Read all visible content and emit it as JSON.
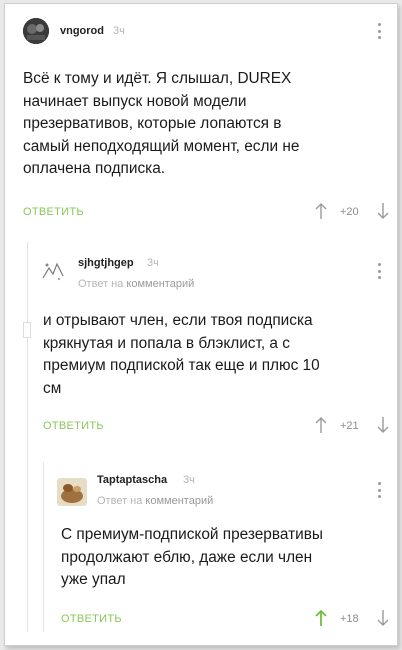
{
  "comments": [
    {
      "username": "vngorod",
      "time": "3ч",
      "text_lines": [
        "Всё к тому и идёт. Я слышал, DUREX",
        "начинает выпуск новой модели",
        "презервативов, которые лопаются в",
        "самый неподходящий момент, если не",
        "оплачена подписка."
      ],
      "reply_label": "ОТВЕТИТЬ",
      "rating": "+20",
      "upvoted": false
    },
    {
      "username": "sjhgtjhgep",
      "time": "3ч",
      "reply_to_prefix": "Ответ на",
      "reply_to_link": "комментарий",
      "text_lines": [
        "и отрывают член, если твоя подписка",
        "крякнутая и попала в блэклист, а с",
        "премиум подпиской так еще и плюс 10",
        "см"
      ],
      "reply_label": "ОТВЕТИТЬ",
      "rating": "+21",
      "upvoted": false
    },
    {
      "username": "Taptaptascha",
      "time": "3ч",
      "reply_to_prefix": "Ответ на",
      "reply_to_link": "комментарий",
      "text_lines": [
        "С премиум-подпиской презервативы",
        "продолжают еблю, даже если член",
        "уже упал"
      ],
      "reply_label": "ОТВЕТИТЬ",
      "rating": "+18",
      "upvoted": true
    }
  ],
  "colors": {
    "accent_green": "#8ac858",
    "muted": "#b5b5b5",
    "text": "#1a1a1a"
  },
  "icons": {
    "upvote": "arrow-up-icon",
    "downvote": "arrow-down-icon",
    "menu": "kebab-menu-icon"
  }
}
